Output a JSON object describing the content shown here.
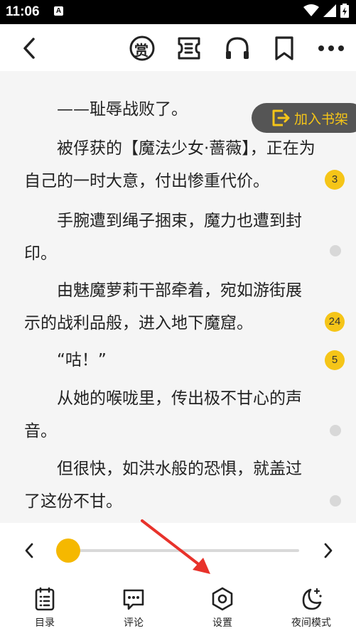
{
  "status_bar": {
    "time": "11:06",
    "notification_icon": "A"
  },
  "toolbar": {
    "back_icon": "chevron-left",
    "reward_icon_label": "赏",
    "icons": [
      "reward-icon",
      "catalog-ticket-icon",
      "headphones-icon",
      "bookmark-icon",
      "more-icon"
    ]
  },
  "reader": {
    "paragraphs": [
      {
        "text": "——耻辱战败了。",
        "comments": null
      },
      {
        "text": "被俘获的【魔法少女·蔷薇】，正在为自己的一时大意，付出惨重代价。",
        "comments": "3"
      },
      {
        "text": "手腕遭到绳子捆束，魔力也遭到封印。",
        "comments": null
      },
      {
        "text": "由魅魔萝莉干部牵着，宛如游街展示的战利品般，进入地下魔窟。",
        "comments": "24"
      },
      {
        "text": "“咕！”",
        "comments": "5"
      },
      {
        "text": "从她的喉咙里，传出极不甘心的声音。",
        "comments": null
      },
      {
        "text": "但很快，如洪水般的恐惧，就盖过了这份不甘。",
        "comments": null
      }
    ],
    "add_to_shelf_label": "加入书架"
  },
  "bottom": {
    "progress": 0.0,
    "nav": [
      {
        "label": "目录",
        "icon": "catalog-icon"
      },
      {
        "label": "评论",
        "icon": "comment-icon"
      },
      {
        "label": "设置",
        "icon": "settings-icon"
      },
      {
        "label": "夜间模式",
        "icon": "night-mode-icon"
      }
    ]
  },
  "colors": {
    "accent": "#f5b800",
    "badge": "#f5c518",
    "annotation_arrow": "#e8322b"
  }
}
